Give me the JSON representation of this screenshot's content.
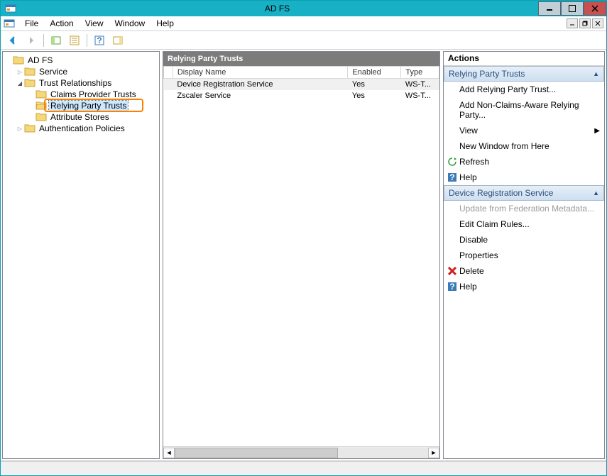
{
  "titlebar": {
    "title": "AD FS"
  },
  "menubar": {
    "items": [
      "File",
      "Action",
      "View",
      "Window",
      "Help"
    ]
  },
  "tree": {
    "root": {
      "label": "AD FS"
    },
    "service": {
      "label": "Service"
    },
    "trust": {
      "label": "Trust Relationships"
    },
    "cp": {
      "label": "Claims Provider Trusts"
    },
    "rp": {
      "label": "Relying Party Trusts"
    },
    "as": {
      "label": "Attribute Stores"
    },
    "auth": {
      "label": "Authentication Policies"
    }
  },
  "center": {
    "header": "Relying Party Trusts",
    "columns": {
      "c1": "Display Name",
      "c2": "Enabled",
      "c3": "Type"
    },
    "rows": [
      {
        "name": "Device Registration Service",
        "enabled": "Yes",
        "type": "WS-T..."
      },
      {
        "name": "Zscaler Service",
        "enabled": "Yes",
        "type": "WS-T..."
      }
    ]
  },
  "actions": {
    "title": "Actions",
    "group1": {
      "header": "Relying Party Trusts",
      "add": "Add Relying Party Trust...",
      "addnc": "Add Non-Claims-Aware Relying Party...",
      "view": "View",
      "newwin": "New Window from Here",
      "refresh": "Refresh",
      "help": "Help"
    },
    "group2": {
      "header": "Device Registration Service",
      "update": "Update from Federation Metadata...",
      "editclaim": "Edit Claim Rules...",
      "disable": "Disable",
      "props": "Properties",
      "delete": "Delete",
      "help": "Help"
    }
  }
}
